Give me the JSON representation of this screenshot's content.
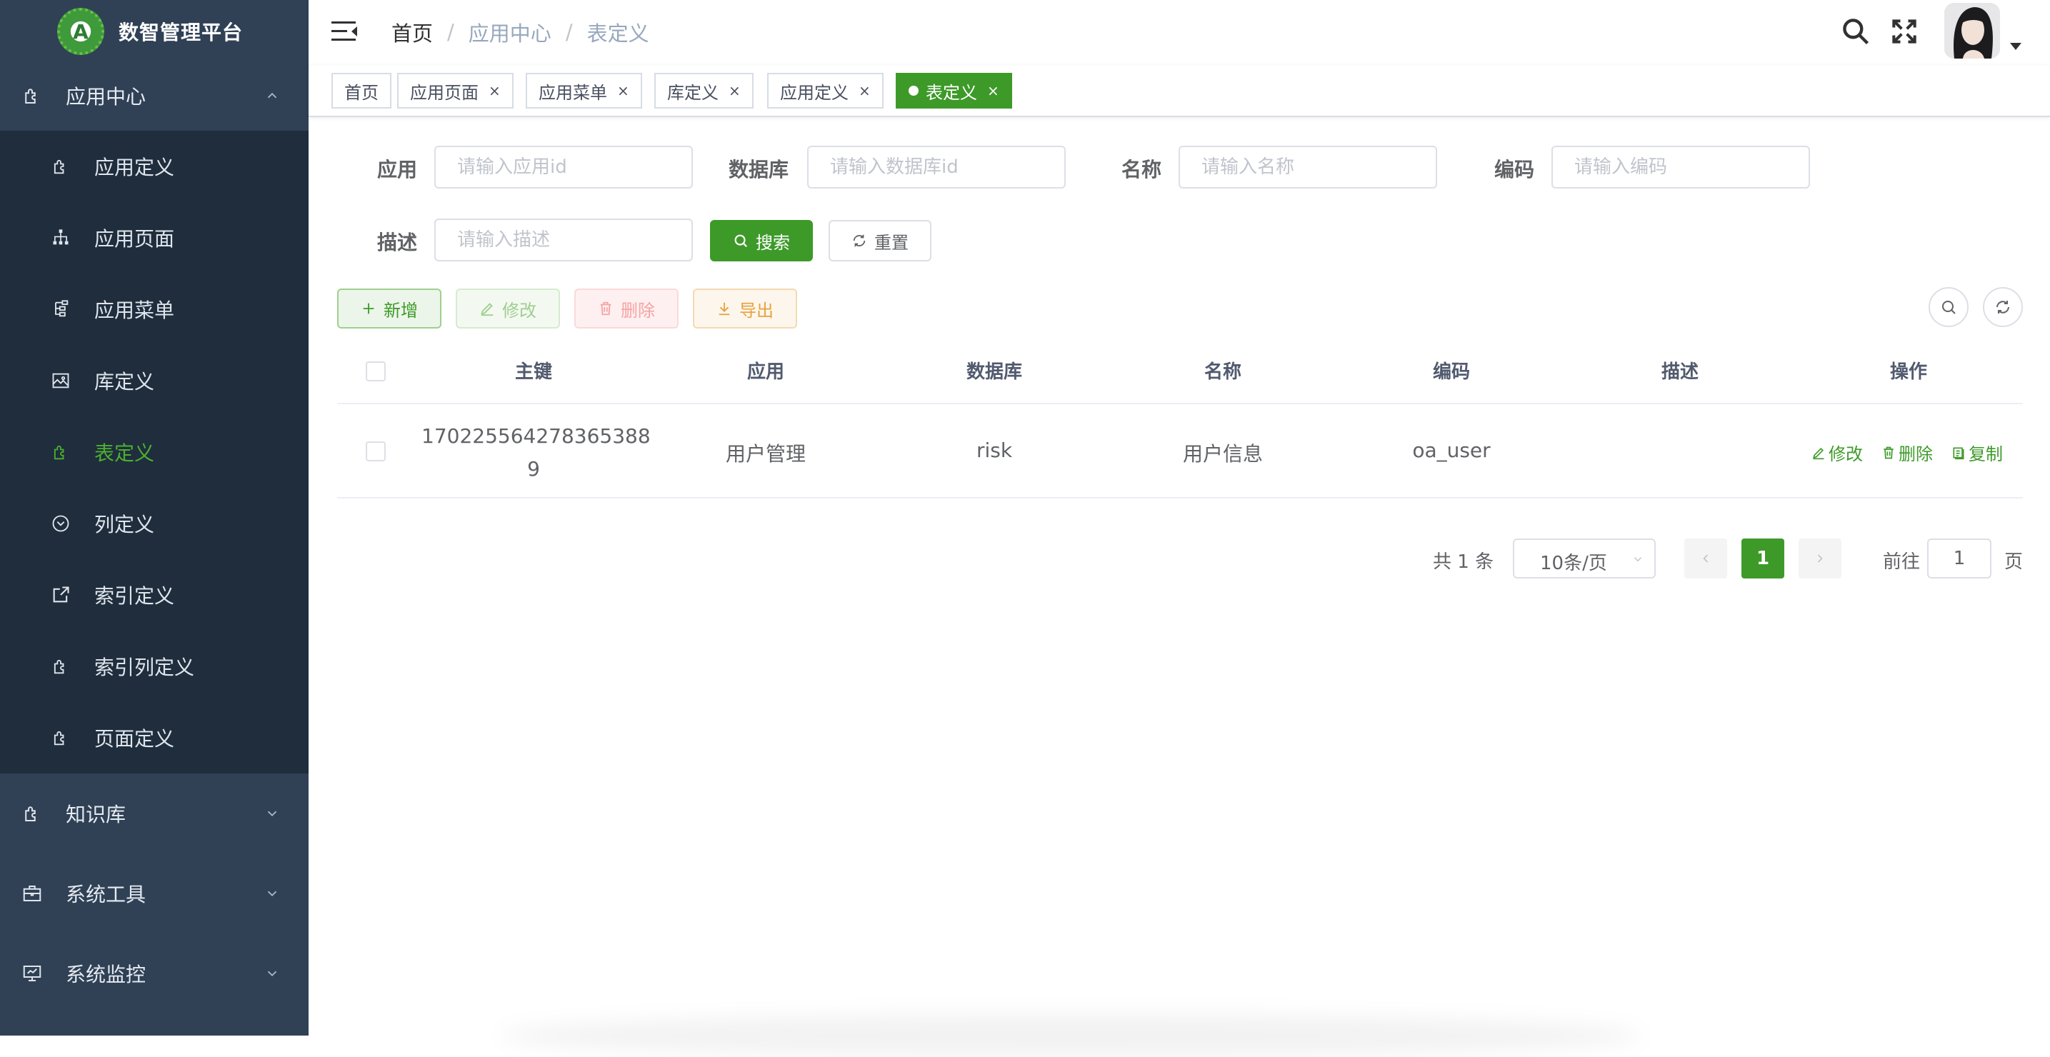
{
  "app": {
    "title": "数智管理平台",
    "logo_letter": "A"
  },
  "colors": {
    "brand": "#3d9a29",
    "sidebar_bg": "#304156",
    "submenu_bg": "#1f2d3d"
  },
  "sidebar": {
    "groups": [
      {
        "label": "应用中心",
        "icon": "puzzle-icon",
        "expanded": true
      },
      {
        "label": "知识库",
        "icon": "puzzle-icon",
        "expanded": false
      },
      {
        "label": "系统工具",
        "icon": "toolbox-icon",
        "expanded": false
      },
      {
        "label": "系统监控",
        "icon": "monitor-icon",
        "expanded": false
      }
    ],
    "items": [
      {
        "label": "应用定义",
        "icon": "puzzle-icon"
      },
      {
        "label": "应用页面",
        "icon": "tree-icon"
      },
      {
        "label": "应用菜单",
        "icon": "tree-list-icon"
      },
      {
        "label": "库定义",
        "icon": "image-icon"
      },
      {
        "label": "表定义",
        "icon": "puzzle-icon",
        "active": true
      },
      {
        "label": "列定义",
        "icon": "chevron-circle-icon"
      },
      {
        "label": "索引定义",
        "icon": "external-link-icon"
      },
      {
        "label": "索引列定义",
        "icon": "puzzle-icon"
      },
      {
        "label": "页面定义",
        "icon": "puzzle-icon"
      }
    ]
  },
  "header": {
    "breadcrumb": [
      "首页",
      "应用中心",
      "表定义"
    ],
    "breadcrumb_sep": "/"
  },
  "tags": [
    {
      "label": "首页",
      "closable": false
    },
    {
      "label": "应用页面",
      "closable": true
    },
    {
      "label": "应用菜单",
      "closable": true
    },
    {
      "label": "库定义",
      "closable": true
    },
    {
      "label": "应用定义",
      "closable": true
    },
    {
      "label": "表定义",
      "closable": true,
      "active": true
    }
  ],
  "tag_close": "×",
  "search": {
    "app_label": "应用",
    "app_placeholder": "请输入应用id",
    "db_label": "数据库",
    "db_placeholder": "请输入数据库id",
    "name_label": "名称",
    "name_placeholder": "请输入名称",
    "code_label": "编码",
    "code_placeholder": "请输入编码",
    "desc_label": "描述",
    "desc_placeholder": "请输入描述",
    "search_button": "搜索",
    "reset_button": "重置"
  },
  "toolbar": {
    "add": "新增",
    "edit": "修改",
    "delete": "删除",
    "export": "导出"
  },
  "table": {
    "headers": [
      "主键",
      "应用",
      "数据库",
      "名称",
      "编码",
      "描述",
      "操作"
    ],
    "rows": [
      {
        "id_line1": "170225564278365388",
        "id_line2": "9",
        "app": "用户管理",
        "db": "risk",
        "name": "用户信息",
        "code": "oa_user",
        "desc": "",
        "ops": [
          "修改",
          "删除",
          "复制"
        ]
      }
    ]
  },
  "pagination": {
    "total_text": "共 1 条",
    "page_size": "10条/页",
    "current_page": "1",
    "goto_label": "前往",
    "goto_value": "1",
    "page_suffix": "页"
  }
}
